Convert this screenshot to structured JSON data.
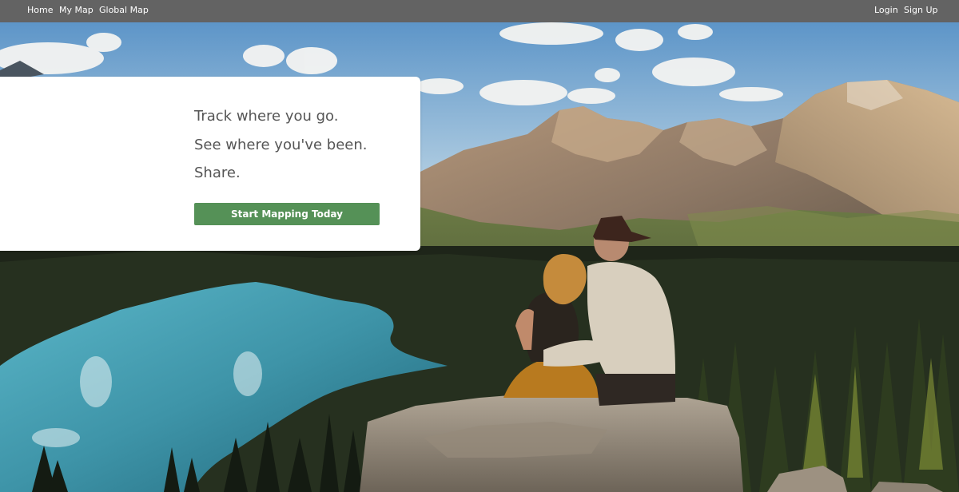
{
  "nav": {
    "home": "Home",
    "my_map": "My Map",
    "global_map": "Global Map",
    "login": "Login",
    "sign_up": "Sign Up"
  },
  "hero": {
    "line1": "Track where you go.",
    "line2": "See where you've been.",
    "line3": "Share.",
    "cta_label": "Start Mapping Today",
    "image_subject": "couple sitting on rock overlooking turquoise mountain lake and forest"
  },
  "colors": {
    "navbar_bg": "#636363",
    "cta_bg": "#559157",
    "card_bg": "#ffffff",
    "tagline_text": "#555555"
  }
}
